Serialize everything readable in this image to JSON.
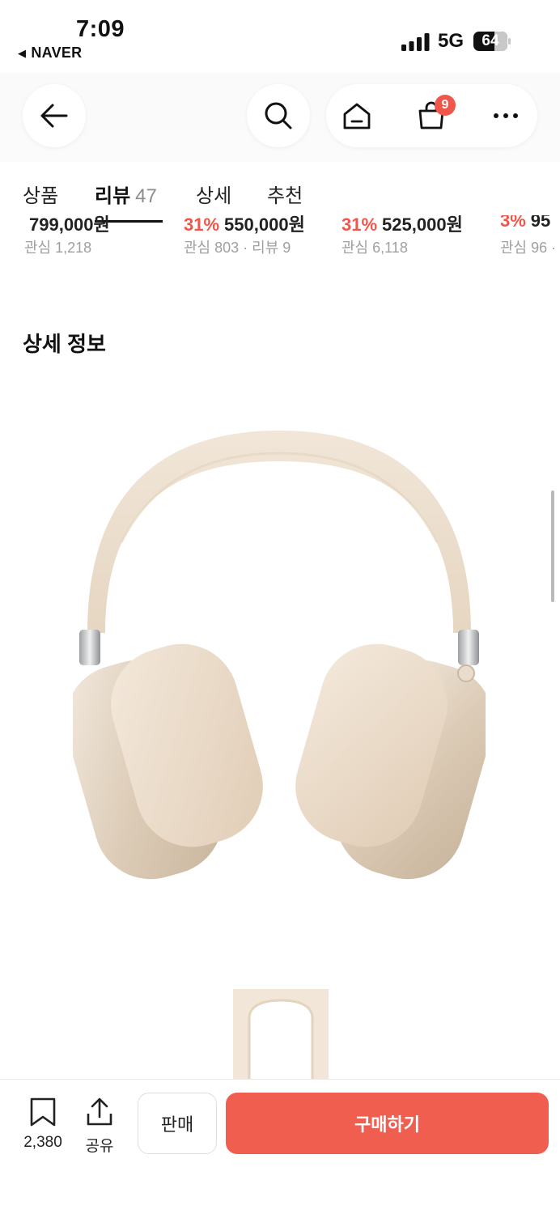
{
  "status_bar": {
    "time": "7:09",
    "back_app": "NAVER",
    "network": "5G",
    "battery": "64"
  },
  "header": {
    "cart_badge": "9"
  },
  "tabs": [
    {
      "label": "상품"
    },
    {
      "label": "리뷰",
      "count": "47"
    },
    {
      "label": "상세"
    },
    {
      "label": "추천"
    }
  ],
  "recommended": [
    {
      "discount": "",
      "price": "799,000원",
      "meta": "관심 1,218"
    },
    {
      "discount": "31%",
      "price": "550,000원",
      "meta": "관심 803 · 리뷰 9"
    },
    {
      "discount": "31%",
      "price": "525,000원",
      "meta": "관심 6,118"
    },
    {
      "discount": "3%",
      "price": "95",
      "meta": "관심 96 ·"
    }
  ],
  "detail": {
    "title": "상세 정보"
  },
  "bottom_bar": {
    "bookmark_count": "2,380",
    "share_label": "공유",
    "seller_label": "판매",
    "buy_label": "구매하기"
  },
  "colors": {
    "accent": "#f05e50",
    "badge": "#f0574a",
    "product": "#efe2d2"
  }
}
